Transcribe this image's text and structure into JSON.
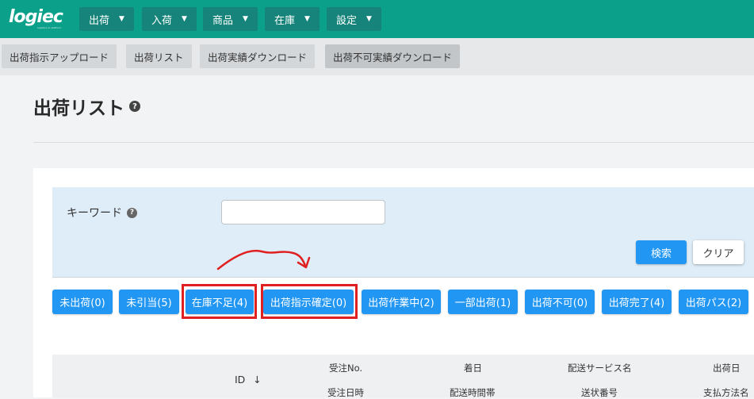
{
  "app": {
    "logo": "logiec",
    "logo_tagline": "logistics ec platform"
  },
  "nav": [
    {
      "label": "出荷"
    },
    {
      "label": "入荷"
    },
    {
      "label": "商品"
    },
    {
      "label": "在庫"
    },
    {
      "label": "設定"
    }
  ],
  "subnav": [
    {
      "label": "出荷指示アップロード"
    },
    {
      "label": "出荷リスト"
    },
    {
      "label": "出荷実績ダウンロード"
    },
    {
      "label": "出荷不可実績ダウンロード"
    }
  ],
  "page": {
    "title": "出荷リスト",
    "help_glyph": "?"
  },
  "search": {
    "keyword_label": "キーワード",
    "keyword_value": "",
    "keyword_placeholder": "",
    "search_button": "検索",
    "clear_button": "クリア"
  },
  "status_filters": [
    {
      "label": "未出荷(0)"
    },
    {
      "label": "未引当(5)"
    },
    {
      "label": "在庫不足(4)"
    },
    {
      "label": "出荷指示確定(0)"
    },
    {
      "label": "出荷作業中(2)"
    },
    {
      "label": "一部出荷(1)"
    },
    {
      "label": "出荷不可(0)"
    },
    {
      "label": "出荷完了(4)"
    },
    {
      "label": "出荷パス(2)"
    }
  ],
  "table": {
    "headers": {
      "id": "ID",
      "id_sort": "↓",
      "order_no": "受注No.",
      "order_datetime": "受注日時",
      "arrival_date": "着日",
      "delivery_time": "配送時間帯",
      "delivery_service": "配送サービス名",
      "tracking_no": "送状番号",
      "ship_date": "出荷日",
      "payment_method": "支払方法名"
    }
  },
  "colors": {
    "header_bg": "#0aa089",
    "primary": "#2196f3",
    "highlight": "#e02020"
  }
}
